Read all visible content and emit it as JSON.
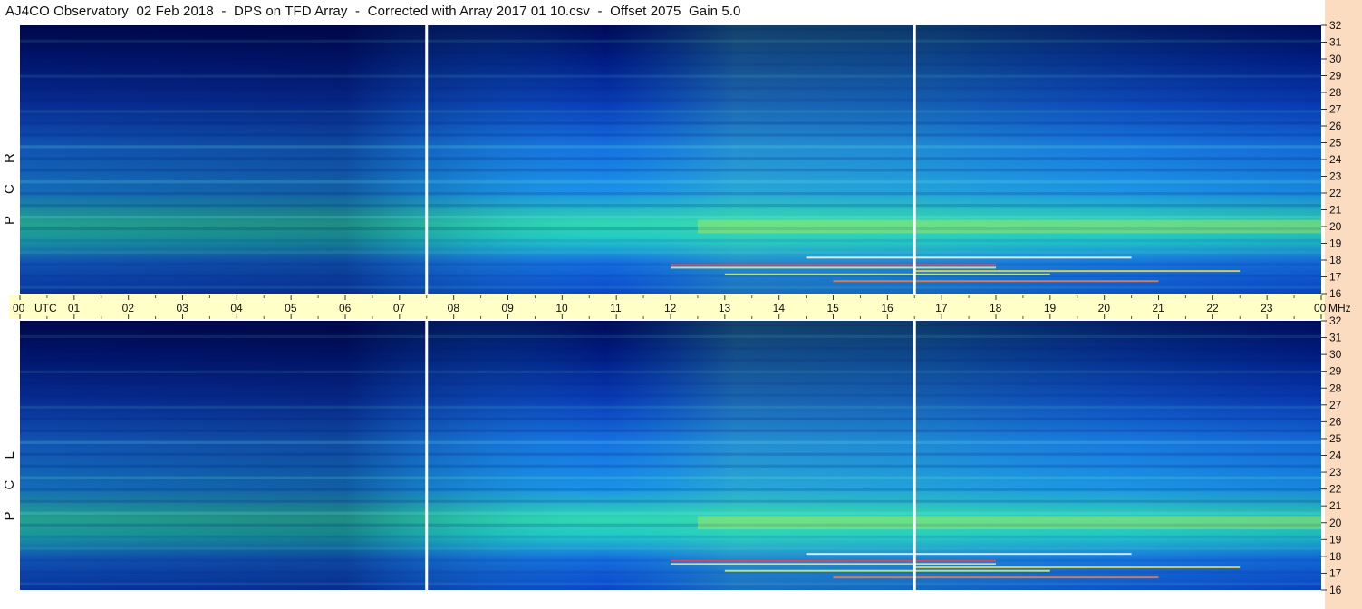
{
  "title": "AJ4CO Observatory  02 Feb 2018  -  DPS on TFD Array  -  Corrected with Array 2017 01 10.csv  -  Offset 2075  Gain 5.0",
  "panels": [
    {
      "label": "R C P",
      "chars": [
        "R",
        "C",
        "P"
      ]
    },
    {
      "label": "L C P",
      "chars": [
        "L",
        "C",
        "P"
      ]
    }
  ],
  "colors": {
    "background_strip": "#fcdcc0",
    "time_axis_band": "#ffffc8",
    "dark": "#000a55",
    "mid": "#1670e0",
    "light": "#30d8b0",
    "hot": "#e8f040"
  },
  "chart_data": {
    "type": "heatmap",
    "title": "AJ4CO Observatory  02 Feb 2018  -  DPS on TFD Array  -  Corrected with Array 2017 01 10.csv  -  Offset 2075  Gain 5.0",
    "x_axis": {
      "unit": "UTC",
      "range": [
        0,
        24
      ],
      "tick_labels": [
        "00",
        "01",
        "02",
        "03",
        "04",
        "05",
        "06",
        "07",
        "08",
        "09",
        "10",
        "11",
        "12",
        "13",
        "14",
        "15",
        "16",
        "17",
        "18",
        "19",
        "20",
        "21",
        "22",
        "23",
        "00"
      ]
    },
    "y_axis": {
      "unit": "MHz",
      "range": [
        16,
        32
      ],
      "tick_labels": [
        "32",
        "31",
        "30",
        "29",
        "28",
        "27",
        "26",
        "25",
        "24",
        "23",
        "22",
        "21",
        "20",
        "19",
        "18",
        "17",
        "16"
      ]
    },
    "utc_label": "UTC",
    "mhz_label": "MHz",
    "series": [
      {
        "name": "R C P"
      },
      {
        "name": "L C P"
      }
    ],
    "time_markers_utc": [
      7.5,
      16.5
    ]
  }
}
